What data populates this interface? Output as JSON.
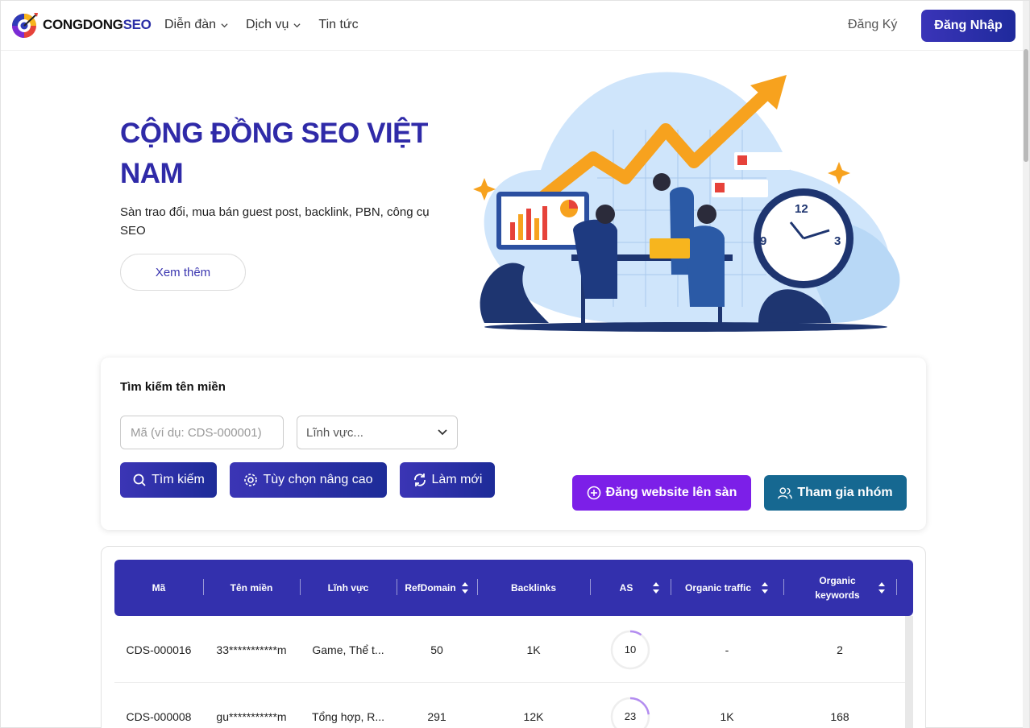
{
  "header": {
    "logo_main": "CONGDONG",
    "logo_accent": "SEO",
    "nav": [
      {
        "label": "Diễn đàn",
        "has_dropdown": true
      },
      {
        "label": "Dịch vụ",
        "has_dropdown": true
      },
      {
        "label": "Tin tức",
        "has_dropdown": false
      }
    ],
    "signup_label": "Đăng Ký",
    "login_label": "Đăng Nhập"
  },
  "hero": {
    "title": "CỘNG ĐỒNG SEO VIỆT NAM",
    "description": "Sàn trao đổi, mua bán guest post, backlink, PBN, công cụ SEO",
    "more_label": "Xem thêm",
    "illustration_numbers": {
      "twelve": "12",
      "three": "3",
      "nine": "9"
    }
  },
  "search": {
    "title": "Tìm kiếm tên miền",
    "code_placeholder": "Mã (ví dụ: CDS-000001)",
    "field_placeholder": "Lĩnh vực...",
    "search_label": "Tìm kiếm",
    "advanced_label": "Tùy chọn nâng cao",
    "refresh_label": "Làm mới",
    "post_label": "Đăng website lên sàn",
    "join_label": "Tham gia nhóm"
  },
  "table": {
    "columns": [
      {
        "label": "Mã",
        "sortable": false
      },
      {
        "label": "Tên miền",
        "sortable": false
      },
      {
        "label": "Lĩnh vực",
        "sortable": false
      },
      {
        "label": "RefDomain",
        "sortable": true
      },
      {
        "label": "Backlinks",
        "sortable": false
      },
      {
        "label": "AS",
        "sortable": true
      },
      {
        "label": "Organic traffic",
        "sortable": true
      },
      {
        "label": "Organic keywords",
        "sortable": true
      }
    ],
    "rows": [
      {
        "code": "CDS-000016",
        "domain": "33***********m",
        "field": "Game, Thể t...",
        "refdomain": "50",
        "backlinks": "1K",
        "as": "10",
        "as_value": 10,
        "traffic": "-",
        "keywords": "2"
      },
      {
        "code": "CDS-000008",
        "domain": "gu***********m",
        "field": "Tổng hợp, R...",
        "refdomain": "291",
        "backlinks": "12K",
        "as": "23",
        "as_value": 23,
        "traffic": "1K",
        "keywords": "168"
      }
    ]
  },
  "colors": {
    "brand": "#2f2aa8",
    "header_row": "#3330ad",
    "post_button": "#7c1fe8",
    "join_button": "#166891",
    "as_ring": "#b38cf0"
  }
}
